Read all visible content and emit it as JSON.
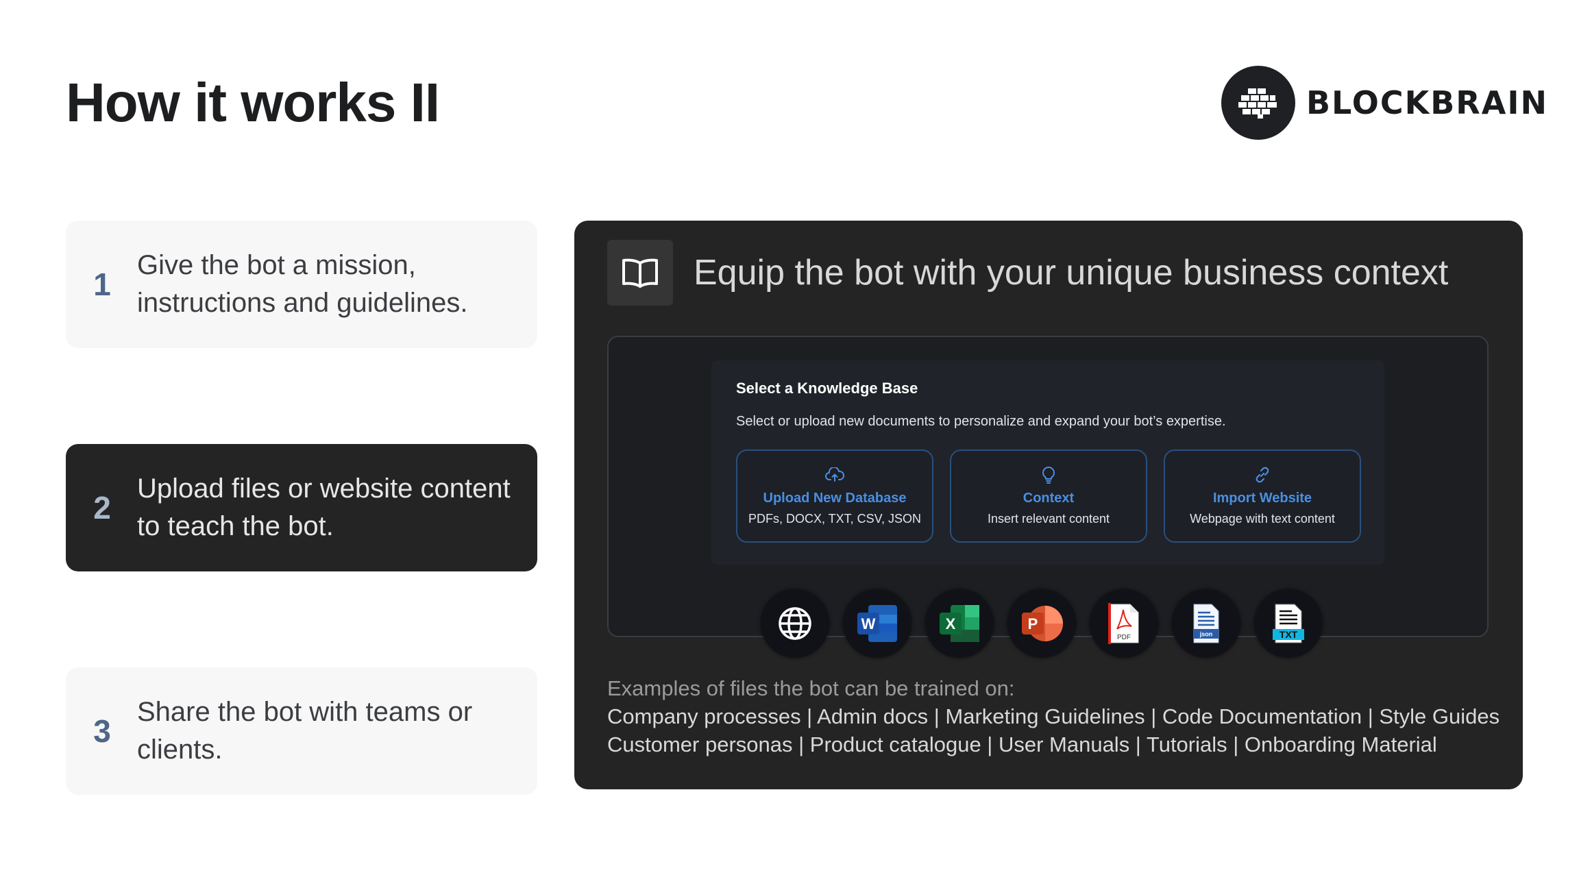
{
  "slide": {
    "title": "How it works II"
  },
  "logo": {
    "text": "BLOCKBRAIN",
    "icon": "brain-icon"
  },
  "steps": [
    {
      "number": "1",
      "text": "Give the bot a mission, instructions and guidelines."
    },
    {
      "number": "2",
      "text": "Upload files or website content to teach the bot."
    },
    {
      "number": "3",
      "text": "Share the bot with teams or clients."
    }
  ],
  "panel": {
    "icon": "book-icon",
    "heading": "Equip the bot with your unique business context",
    "knowledge_base": {
      "title": "Select a Knowledge Base",
      "subtitle": "Select or upload new documents to personalize and expand your bot’s expertise.",
      "options": [
        {
          "icon": "cloud-upload-icon",
          "label": "Upload New Database",
          "desc": "PDFs, DOCX, TXT, CSV, JSON"
        },
        {
          "icon": "lightbulb-icon",
          "label": "Context",
          "desc": "Insert relevant content"
        },
        {
          "icon": "link-icon",
          "label": "Import Website",
          "desc": "Webpage with text content"
        }
      ]
    },
    "file_types": [
      {
        "icon": "globe-icon"
      },
      {
        "icon": "word-icon",
        "label": "W"
      },
      {
        "icon": "excel-icon",
        "label": "X"
      },
      {
        "icon": "powerpoint-icon",
        "label": "P"
      },
      {
        "icon": "pdf-icon",
        "label": "PDF"
      },
      {
        "icon": "json-icon",
        "label": "json"
      },
      {
        "icon": "txt-icon",
        "label": "TXT"
      }
    ],
    "examples": {
      "intro": "Examples of files the bot can be trained on:",
      "line1": "Company processes | Admin docs | Marketing Guidelines | Code Documentation | Style Guides",
      "line2": "Customer personas | Product catalogue | User Manuals | Tutorials | Onboarding Material"
    }
  },
  "colors": {
    "accent_blue": "#4a8fe2",
    "step_number": "#4e6788",
    "panel_bg": "#242424"
  }
}
